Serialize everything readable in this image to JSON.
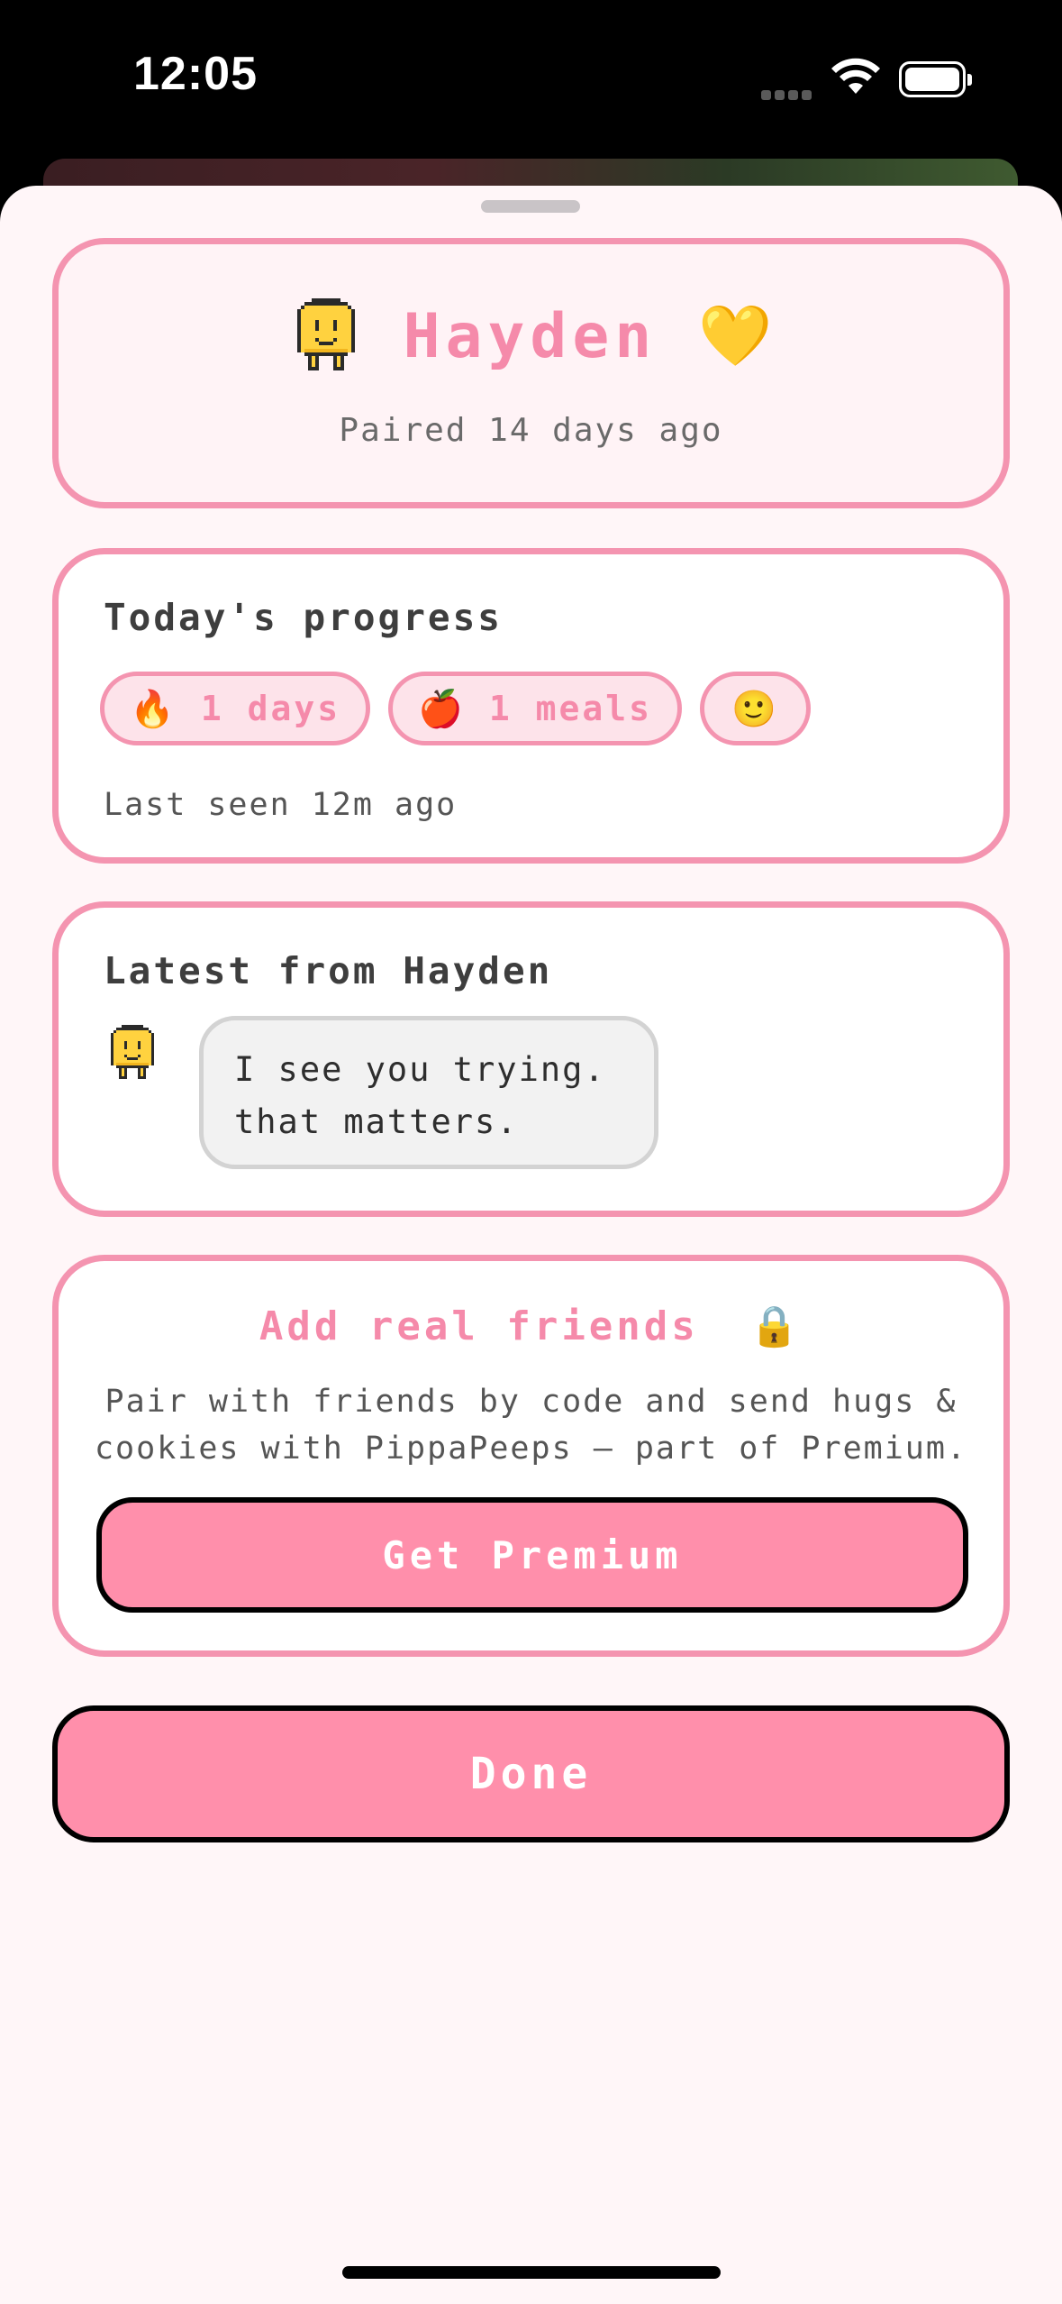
{
  "status_bar": {
    "time": "12:05"
  },
  "partner": {
    "avatar_icon": "smiley-pixel-icon",
    "name": "Hayden",
    "heart": "💛",
    "paired_text": "Paired 14 days ago"
  },
  "progress": {
    "title": "Today's progress",
    "streak": {
      "emoji": "🔥",
      "label": "1 days"
    },
    "meals": {
      "emoji": "🍎",
      "label": "1 meals"
    },
    "mood": {
      "emoji": "🙂"
    },
    "last_seen": "Last seen 12m ago"
  },
  "latest": {
    "title": "Latest from Hayden",
    "message_lines": [
      "I see you trying.",
      "that matters."
    ]
  },
  "friends": {
    "title": "Add real friends",
    "lock": "🔒",
    "desc_lines": [
      "Pair with friends by code and send hugs &",
      "cookies with PippaPeeps — part of Premium."
    ],
    "cta": "Get Premium"
  },
  "done_label": "Done",
  "colors": {
    "accent": "#ff8fab",
    "border": "#f494b0",
    "title_pink": "#f58aaa",
    "sheet_bg": "#fff6f8"
  }
}
